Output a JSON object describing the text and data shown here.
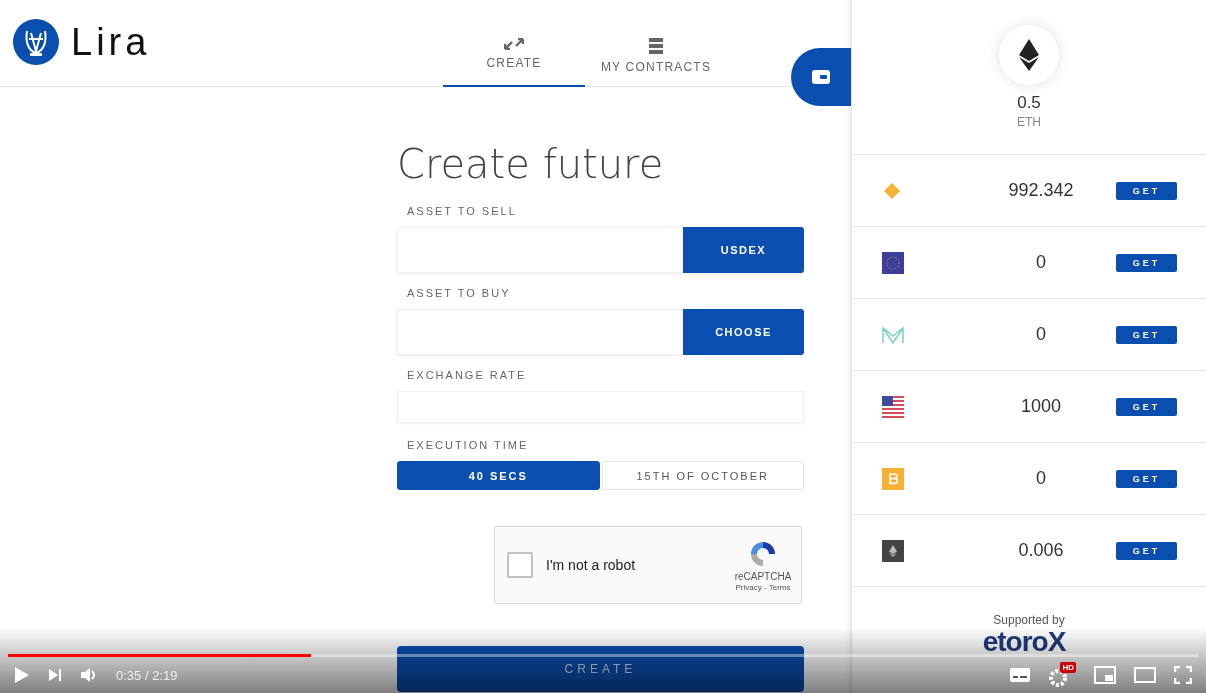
{
  "brand": {
    "name": "Lira"
  },
  "tabs": [
    {
      "label": "CREATE",
      "kind": "create",
      "selected": true
    },
    {
      "label": "MY CONTRACTS",
      "kind": "contracts",
      "selected": false
    }
  ],
  "form": {
    "title": "Create future",
    "fields": [
      {
        "kind": "select",
        "label": "ASSET TO SELL",
        "button": "USDEX"
      },
      {
        "kind": "select",
        "label": "ASSET TO BUY",
        "button": "CHOOSE"
      },
      {
        "kind": "text",
        "label": "EXCHANGE RATE"
      },
      {
        "kind": "toggle",
        "label": "EXECUTION TIME",
        "options": [
          {
            "label": "40 SECS",
            "selected": true
          },
          {
            "label": "15TH OF OCTOBER",
            "selected": false
          }
        ]
      }
    ],
    "captcha": {
      "label": "I'm not a robot",
      "checked": false,
      "brand": "reCAPTCHA",
      "links": "Privacy - Terms"
    },
    "submit": "CREATE"
  },
  "wallet": {
    "balance": "0.5",
    "unit": "ETH",
    "assets": [
      {
        "kind": "diamond",
        "amount": "992.342",
        "action": "GET"
      },
      {
        "kind": "eu-flag",
        "amount": "0",
        "action": "GET"
      },
      {
        "kind": "maker",
        "amount": "0",
        "action": "GET"
      },
      {
        "kind": "us-flag",
        "amount": "1000",
        "action": "GET"
      },
      {
        "kind": "bitcoin",
        "amount": "0",
        "action": "GET"
      },
      {
        "kind": "ether",
        "amount": "0.006",
        "action": "GET"
      }
    ],
    "supported_by": "Supported by",
    "sponsor": "etoroX"
  },
  "player": {
    "level": 0.255,
    "time": "0:35 / 2:19",
    "badge": "HD"
  }
}
